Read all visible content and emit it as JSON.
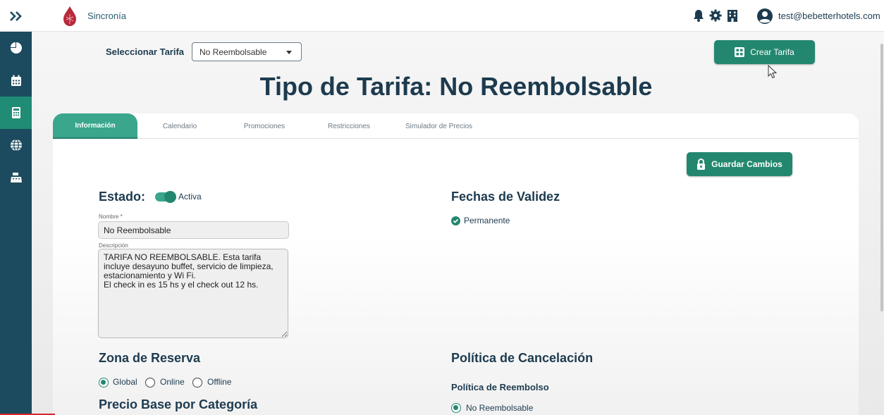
{
  "header": {
    "app_name": "Sincronía",
    "user_email": "test@bebetterhotels.com",
    "icons": [
      "bell-icon",
      "gear-icon",
      "building-icon",
      "user-avatar-icon"
    ]
  },
  "sidebar": {
    "items": [
      {
        "icon": "pie-chart-icon"
      },
      {
        "icon": "calendar-icon"
      },
      {
        "icon": "calculator-icon",
        "active": true
      },
      {
        "icon": "globe-icon"
      },
      {
        "icon": "cash-register-icon"
      }
    ]
  },
  "toolbar": {
    "select_label": "Seleccionar Tarifa",
    "select_value": "No Reembolsable",
    "crear_label": "Crear Tarifa"
  },
  "page_title": "Tipo de Tarifa: No Reembolsable",
  "tabs": [
    {
      "label": "Información",
      "active": true
    },
    {
      "label": "Calendario"
    },
    {
      "label": "Promociones"
    },
    {
      "label": "Restricciones"
    },
    {
      "label": "Simulador de Precios"
    }
  ],
  "guardar_label": "Guardar Cambios",
  "estado": {
    "title": "Estado:",
    "toggle_label": "Activa"
  },
  "form": {
    "nombre_label": "Nombre *",
    "nombre_value": "No Reembolsable",
    "descripcion_label": "Descripción",
    "descripcion_value": "TARIFA NO REEMBOLSABLE. Esta tarifa\nincluye desayuno buffet, servicio de limpieza,\nestacionamiento y Wi Fi.\nEl check in es 15 hs y el check out 12 hs."
  },
  "validez": {
    "title": "Fechas de Validez",
    "option": "Permanente"
  },
  "zona": {
    "title": "Zona de Reserva",
    "options": [
      "Global",
      "Online",
      "Offline"
    ],
    "selected": "Global"
  },
  "precio": {
    "title": "Precio Base por Categoría"
  },
  "cancelacion": {
    "title": "Política de Cancelación",
    "sub_title": "Política de Reembolso",
    "option": "No Reembolsable"
  },
  "colors": {
    "primary_green": "#23876f",
    "sidebar": "#1c4a5e",
    "text_dark": "#1d3b4f"
  }
}
